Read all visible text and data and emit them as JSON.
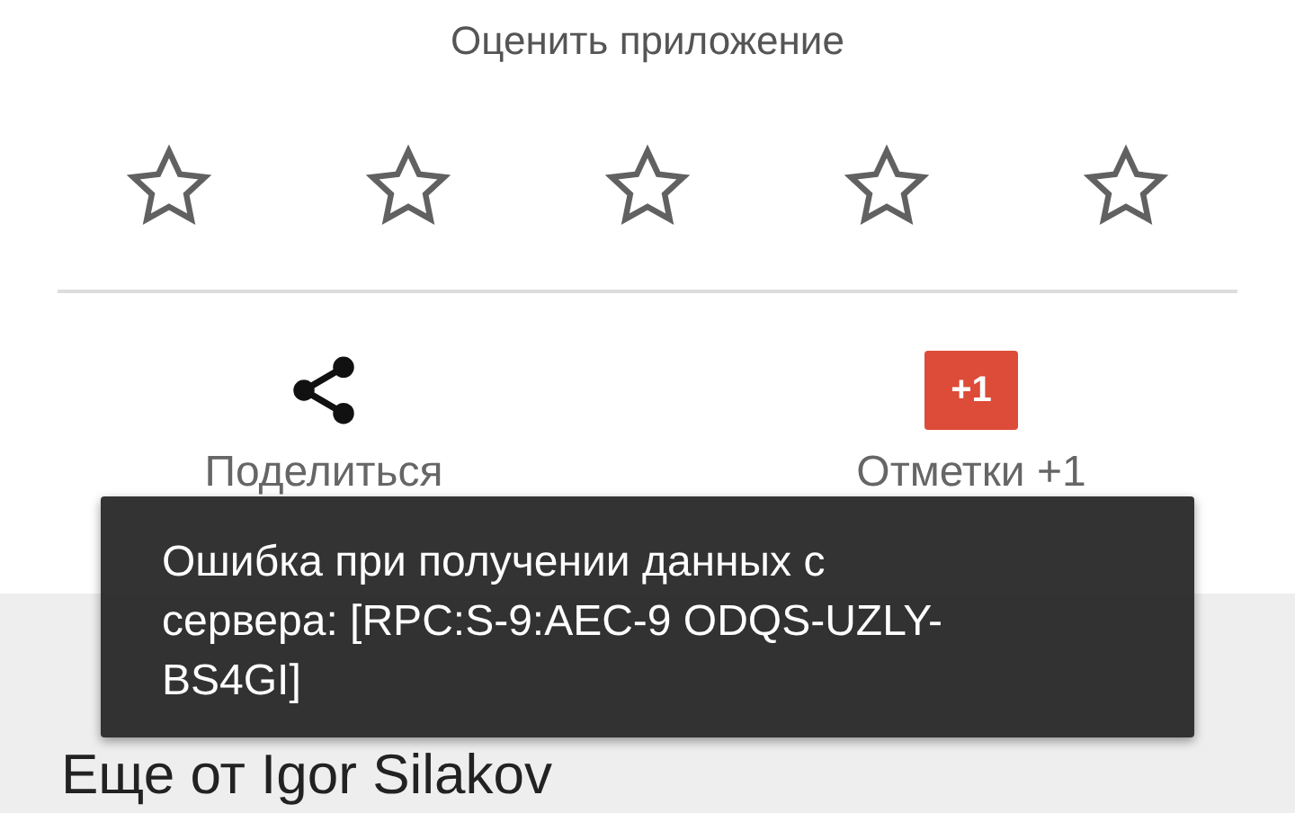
{
  "rating": {
    "prompt": "Оценить приложение",
    "stars": 0
  },
  "actions": [
    {
      "kind": "share",
      "label": "Поделиться"
    },
    {
      "kind": "plusone",
      "badge": "+1",
      "label": "Отметки +1"
    }
  ],
  "more_section": {
    "title": "Еще от Igor Silakov"
  },
  "toast": {
    "message": "Ошибка при получении данных с сервера: [RPC:S-9:AEC-9 ODQS-UZLY-BS4GI]"
  }
}
